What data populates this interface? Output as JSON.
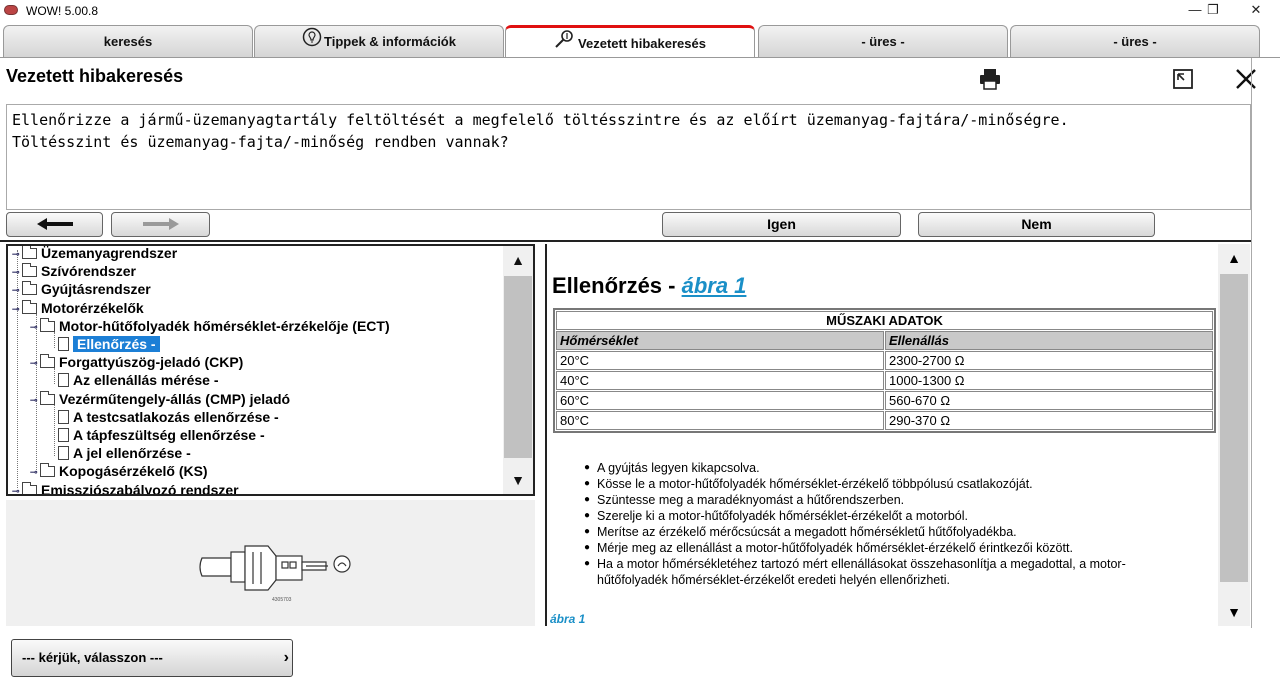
{
  "window": {
    "title": "WOW! 5.00.8",
    "minimize": "—",
    "restore": "❐",
    "close": "✕"
  },
  "tabs": [
    {
      "label": "keresés",
      "icon": ""
    },
    {
      "label": "Tippek & információk",
      "icon": "lightbulb-icon"
    },
    {
      "label": "Vezetett hibakeresés",
      "icon": "probe-icon",
      "active": true
    },
    {
      "label": "- üres -",
      "icon": ""
    },
    {
      "label": "- üres -",
      "icon": ""
    }
  ],
  "header": {
    "title": "Vezetett hibakeresés",
    "print_icon": "printer-icon",
    "expand_icon": "expand-icon",
    "close_icon": "close-icon"
  },
  "question": {
    "line1": "Ellenőrizze a jármű-üzemanyagtartály feltöltését a megfelelő töltésszintre és az előírt üzemanyag-fajtára/-minőségre.",
    "line2": "Töltésszint és üzemanyag-fajta/-minőség rendben vannak?"
  },
  "nav": {
    "back_icon": "arrow-left-icon",
    "forward_icon": "arrow-right-icon",
    "yes_label": "Igen",
    "no_label": "Nem"
  },
  "tree": {
    "items": [
      {
        "label": "Üzemanyagrendszer",
        "level": 0,
        "type": "folder"
      },
      {
        "label": "Szívórendszer",
        "level": 0,
        "type": "folder"
      },
      {
        "label": "Gyújtásrendszer",
        "level": 0,
        "type": "folder"
      },
      {
        "label": "Motorérzékelők",
        "level": 0,
        "type": "folder"
      },
      {
        "label": "Motor-hűtőfolyadék hőmérséklet-érzékelője (ECT)",
        "level": 1,
        "type": "folder"
      },
      {
        "label": "Ellenőrzés -",
        "level": 2,
        "type": "doc",
        "selected": true
      },
      {
        "label": "Forgattyúszög-jeladó (CKP)",
        "level": 1,
        "type": "folder"
      },
      {
        "label": "Az ellenállás mérése -",
        "level": 2,
        "type": "doc"
      },
      {
        "label": "Vezérműtengely-állás (CMP) jeladó",
        "level": 1,
        "type": "folder"
      },
      {
        "label": "A testcsatlakozás ellenőrzése -",
        "level": 2,
        "type": "doc"
      },
      {
        "label": "A tápfeszültség ellenőrzése -",
        "level": 2,
        "type": "doc"
      },
      {
        "label": "A jel ellenőrzése -",
        "level": 2,
        "type": "doc"
      },
      {
        "label": "Kopogásérzékelő (KS)",
        "level": 1,
        "type": "folder"
      },
      {
        "label": "Emissziószabályozó rendszer",
        "level": 0,
        "type": "folder"
      }
    ],
    "scroll_fraction": 0.2
  },
  "content": {
    "title": "Ellenőrzés - ",
    "title_link": "ábra 1",
    "table": {
      "caption": "MŰSZAKI ADATOK",
      "headers": [
        "Hőmérséklet",
        "Ellenállás"
      ],
      "rows": [
        [
          "20°C",
          "2300-2700 Ω"
        ],
        [
          "40°C",
          "1000-1300 Ω"
        ],
        [
          "60°C",
          "560-670 Ω"
        ],
        [
          "80°C",
          "290-370 Ω"
        ]
      ]
    },
    "steps": [
      "A gyújtás legyen kikapcsolva.",
      "Kösse le a motor-hűtőfolyadék hőmérséklet-érzékelő többpólusú csatlakozóját.",
      "Szüntesse meg a maradéknyomást a hűtőrendszerben.",
      "Szerelje ki a motor-hűtőfolyadék hőmérséklet-érzékelőt a motorból.",
      "Merítse az érzékelő mérőcsúcsát a megadott hőmérsékletű hűtőfolyadékba.",
      "Mérje meg az ellenállást a motor-hűtőfolyadék hőmérséklet-érzékelő érintkezői között.",
      "Ha a motor hőmérsékletéhez tartozó mért ellenállásokat összehasonlítja a megadottal, a motor-hűtőfolyadék hőmérséklet-érzékelőt eredeti helyén ellenőrizheti."
    ],
    "caption": "ábra 1"
  },
  "preview": {
    "image_icon": "sensor-diagram-icon",
    "figure_code": "4305703"
  },
  "bottom": {
    "select_label": "--- kérjük, válasszon ---",
    "chevron": "›"
  }
}
